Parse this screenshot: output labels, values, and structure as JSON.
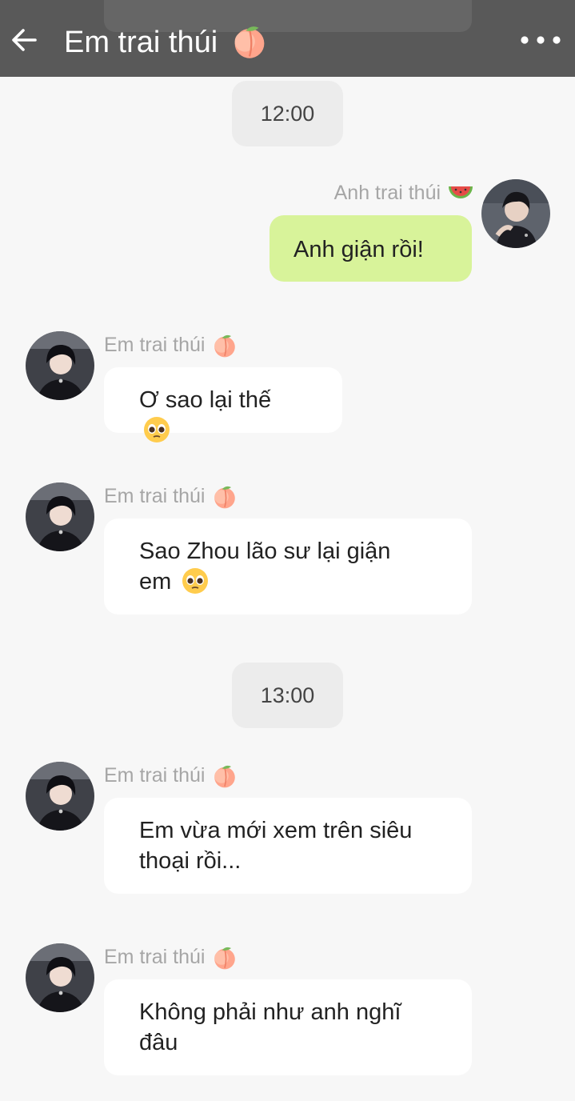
{
  "header": {
    "title": "Em trai thúi",
    "title_emoji": "peach-emoji",
    "back_icon": "back-arrow-icon",
    "more_icon": "more-dots-icon",
    "bg_color": "#595959"
  },
  "timestamps": [
    "12:00",
    "13:00"
  ],
  "me": {
    "name": "Anh trai thúi",
    "name_emoji": "watermelon-emoji",
    "bubble_color": "#d8f39a"
  },
  "other": {
    "name": "Em trai thúi",
    "name_emoji": "peach-emoji",
    "bubble_color": "#ffffff"
  },
  "messages": [
    {
      "sender": "me",
      "text": "Anh giận rồi!"
    },
    {
      "sender": "other",
      "text": "Ơ sao lại thế",
      "emoji": "pleading-face-emoji"
    },
    {
      "sender": "other",
      "line1": "Sao Zhou lão sư lại giận",
      "line2": "em",
      "emoji": "pleading-face-emoji"
    },
    {
      "sender": "other",
      "line1": "Em vừa mới xem trên siêu",
      "line2": "thoại rồi..."
    },
    {
      "sender": "other",
      "line1": "Không phải như anh nghĩ",
      "line2": "đâu"
    }
  ]
}
